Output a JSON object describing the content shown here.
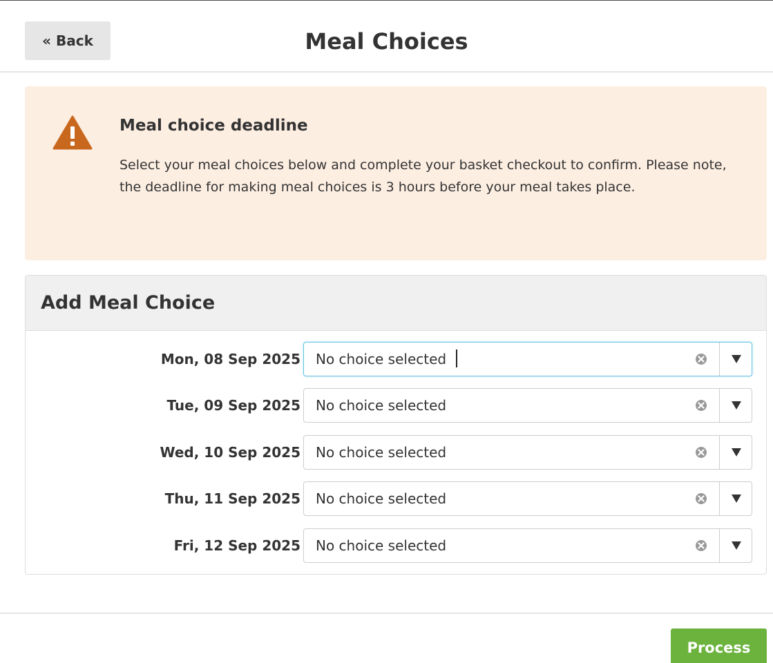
{
  "header": {
    "back_label": "« Back",
    "title": "Meal Choices"
  },
  "alert": {
    "icon": "warning-triangle-icon",
    "title": "Meal choice deadline",
    "text": "Select your meal choices below and complete your basket checkout to confirm. Please note, the deadline for making meal choices is 3 hours before your meal takes place."
  },
  "panel": {
    "title": "Add Meal Choice",
    "rows": [
      {
        "date": "Mon, 08 Sep 2025",
        "value": "No choice selected"
      },
      {
        "date": "Tue, 09 Sep 2025",
        "value": "No choice selected"
      },
      {
        "date": "Wed, 10 Sep 2025",
        "value": "No choice selected"
      },
      {
        "date": "Thu, 11 Sep 2025",
        "value": "No choice selected"
      },
      {
        "date": "Fri, 12 Sep 2025",
        "value": "No choice selected"
      }
    ]
  },
  "footer": {
    "process_label": "Process"
  },
  "colors": {
    "alert_bg": "#fdeee2",
    "warning_icon": "#c8681e",
    "process_button": "#6cb33e",
    "focus_border": "#66c4e4"
  }
}
